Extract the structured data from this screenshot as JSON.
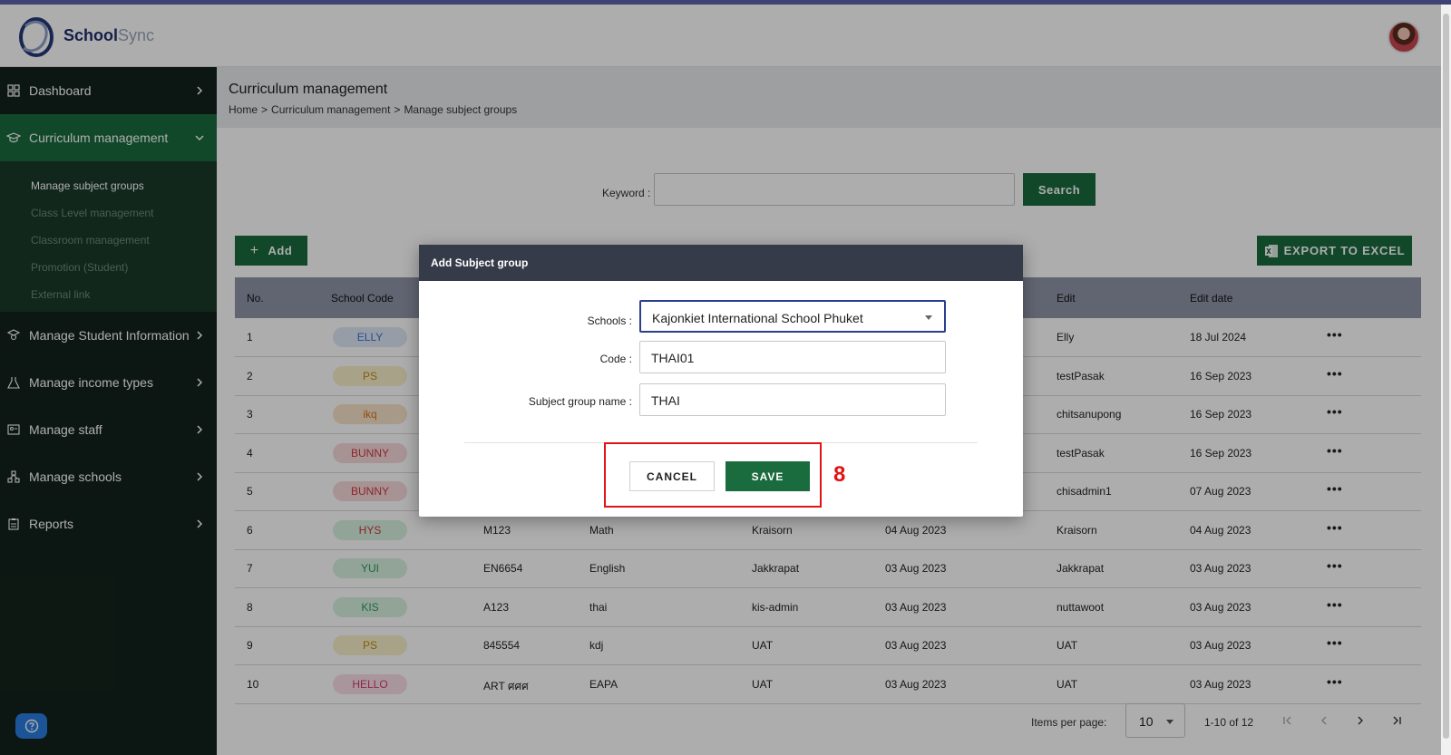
{
  "app": {
    "brand_part1": "School",
    "brand_part2": "Sync"
  },
  "sidebar": {
    "items": [
      {
        "label": "Dashboard",
        "icon": "dashboard-grid-icon"
      },
      {
        "label": "Curriculum management",
        "icon": "graduation-cap-icon"
      },
      {
        "label": "Manage Student Information",
        "icon": "student-icon"
      },
      {
        "label": "Manage income types",
        "icon": "flask-icon"
      },
      {
        "label": "Manage staff",
        "icon": "staff-board-icon"
      },
      {
        "label": "Manage schools",
        "icon": "school-network-icon"
      },
      {
        "label": "Reports",
        "icon": "clipboard-icon"
      }
    ],
    "subitems": [
      {
        "label": "Manage subject groups"
      },
      {
        "label": "Class Level management"
      },
      {
        "label": "Classroom management"
      },
      {
        "label": "Promotion (Student)"
      },
      {
        "label": "External link"
      }
    ]
  },
  "page": {
    "title": "Curriculum management",
    "breadcrumb": [
      "Home",
      ">",
      "Curriculum management",
      ">",
      "Manage subject groups"
    ]
  },
  "search": {
    "label": "Keyword :",
    "value": "",
    "button": "Search"
  },
  "actions": {
    "add": "Add",
    "export": "EXPORT TO EXCEL"
  },
  "table": {
    "headers": [
      "No.",
      "School Code",
      "Edit",
      "Edit date"
    ],
    "rows": [
      {
        "no": "1",
        "school_code": "ELLY",
        "badge_color": "#dfe8f7",
        "badge_text_color": "#3b6fcf",
        "code": "",
        "name": "",
        "created_by": "",
        "created_date": "",
        "edit": "Elly",
        "edit_date": "18 Jul 2024"
      },
      {
        "no": "2",
        "school_code": "PS",
        "badge_color": "#f7efc9",
        "badge_text_color": "#c08a15",
        "code": "",
        "name": "",
        "created_by": "",
        "created_date": "",
        "edit": "testPasak",
        "edit_date": "16 Sep 2023"
      },
      {
        "no": "3",
        "school_code": "ikq",
        "badge_color": "#f8e3c9",
        "badge_text_color": "#d2721b",
        "code": "",
        "name": "",
        "created_by": "",
        "created_date": "",
        "edit": "chitsanupong",
        "edit_date": "16 Sep 2023"
      },
      {
        "no": "4",
        "school_code": "BUNNY",
        "badge_color": "#f7d9db",
        "badge_text_color": "#d0383f",
        "code": "",
        "name": "",
        "created_by": "",
        "created_date": "",
        "edit": "testPasak",
        "edit_date": "16 Sep 2023"
      },
      {
        "no": "5",
        "school_code": "BUNNY",
        "badge_color": "#f7d9db",
        "badge_text_color": "#d0383f",
        "code": "",
        "name": "",
        "created_by": "",
        "created_date": "",
        "edit": "chisadmin1",
        "edit_date": "07 Aug 2023"
      },
      {
        "no": "6",
        "school_code": "HYS",
        "badge_color": "#d7f0e1",
        "badge_text_color": "#d0383f",
        "code": "M123",
        "name": "Math",
        "created_by": "Kraisorn",
        "created_date": "04 Aug 2023",
        "edit": "Kraisorn",
        "edit_date": "04 Aug 2023"
      },
      {
        "no": "7",
        "school_code": "YUI",
        "badge_color": "#d7f0e1",
        "badge_text_color": "#2f9a57",
        "code": "EN6654",
        "name": "English",
        "created_by": "Jakkrapat",
        "created_date": "03 Aug 2023",
        "edit": "Jakkrapat",
        "edit_date": "03 Aug 2023"
      },
      {
        "no": "8",
        "school_code": "KIS",
        "badge_color": "#d7f0e1",
        "badge_text_color": "#2f9a57",
        "code": "A123",
        "name": "thai",
        "created_by": "kis-admin",
        "created_date": "03 Aug 2023",
        "edit": "nuttawoot",
        "edit_date": "03 Aug 2023"
      },
      {
        "no": "9",
        "school_code": "PS",
        "badge_color": "#f7efc9",
        "badge_text_color": "#c08a15",
        "code": "845554",
        "name": "kdj",
        "created_by": "UAT",
        "created_date": "03 Aug 2023",
        "edit": "UAT",
        "edit_date": "03 Aug 2023"
      },
      {
        "no": "10",
        "school_code": "HELLO",
        "badge_color": "#f9dde8",
        "badge_text_color": "#d0386f",
        "code": "ART ศศศ",
        "name": "EAPA",
        "created_by": "UAT",
        "created_date": "03 Aug 2023",
        "edit": "UAT",
        "edit_date": "03 Aug 2023"
      }
    ],
    "row_menu": "•••"
  },
  "pagination": {
    "label": "Items per page:",
    "per_page": "10",
    "range": "1-10 of 12"
  },
  "modal": {
    "title": "Add Subject group",
    "schools_label": "Schools :",
    "schools_value": "Kajonkiet International School Phuket",
    "code_label": "Code :",
    "code_value": "THAI01",
    "name_label": "Subject group name :",
    "name_value": "THAI",
    "cancel": "CANCEL",
    "save": "SAVE",
    "step_number": "8"
  },
  "colors": {
    "brand_green": "#1a6b3e",
    "sidebar_bg": "#13231c",
    "annotation_red": "#e01414",
    "modal_header": "#353b48"
  }
}
